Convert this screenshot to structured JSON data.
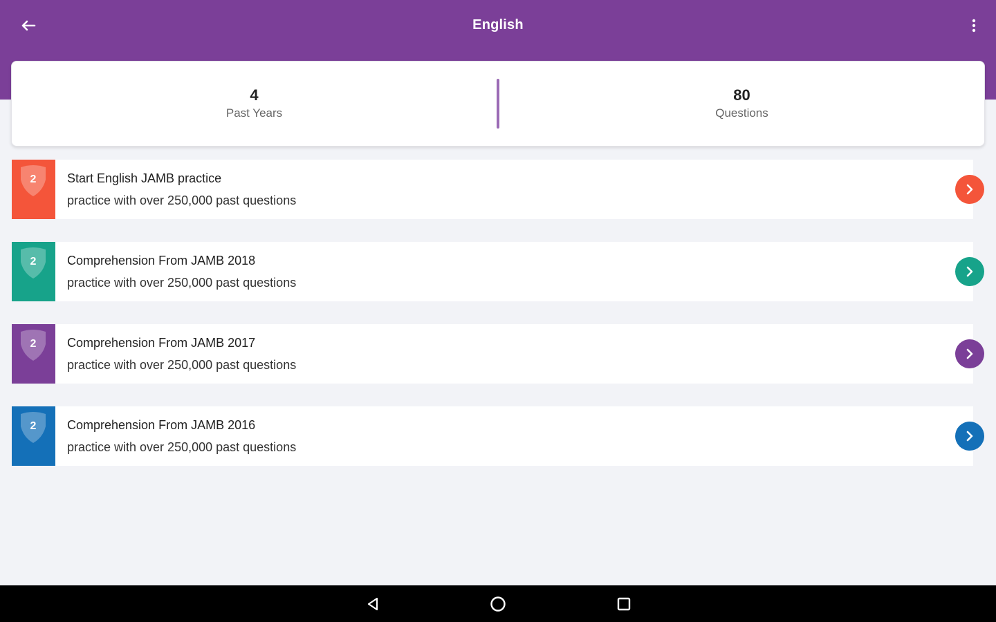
{
  "header": {
    "title": "English",
    "color": "#7b3f98"
  },
  "stats": [
    {
      "value": "4",
      "label": "Past Years"
    },
    {
      "value": "80",
      "label": "Questions"
    }
  ],
  "items": [
    {
      "badge": "2",
      "title": "Start English JAMB practice",
      "subtitle": "practice with over 250,000 past questions",
      "color": "#f4553a"
    },
    {
      "badge": "2",
      "title": "Comprehension From JAMB 2018",
      "subtitle": "practice with over 250,000 past questions",
      "color": "#17a38a"
    },
    {
      "badge": "2",
      "title": "Comprehension From JAMB 2017",
      "subtitle": "practice with over 250,000 past questions",
      "color": "#7b3f98"
    },
    {
      "badge": "2",
      "title": "Comprehension From JAMB 2016",
      "subtitle": "practice with over 250,000 past questions",
      "color": "#1470b8"
    }
  ],
  "icons": {
    "back": "arrow-left-icon",
    "menu": "more-vert-icon",
    "arrow": "chevron-right-icon",
    "nav_back": "triangle-back-icon",
    "nav_home": "circle-home-icon",
    "nav_recents": "square-recents-icon"
  }
}
